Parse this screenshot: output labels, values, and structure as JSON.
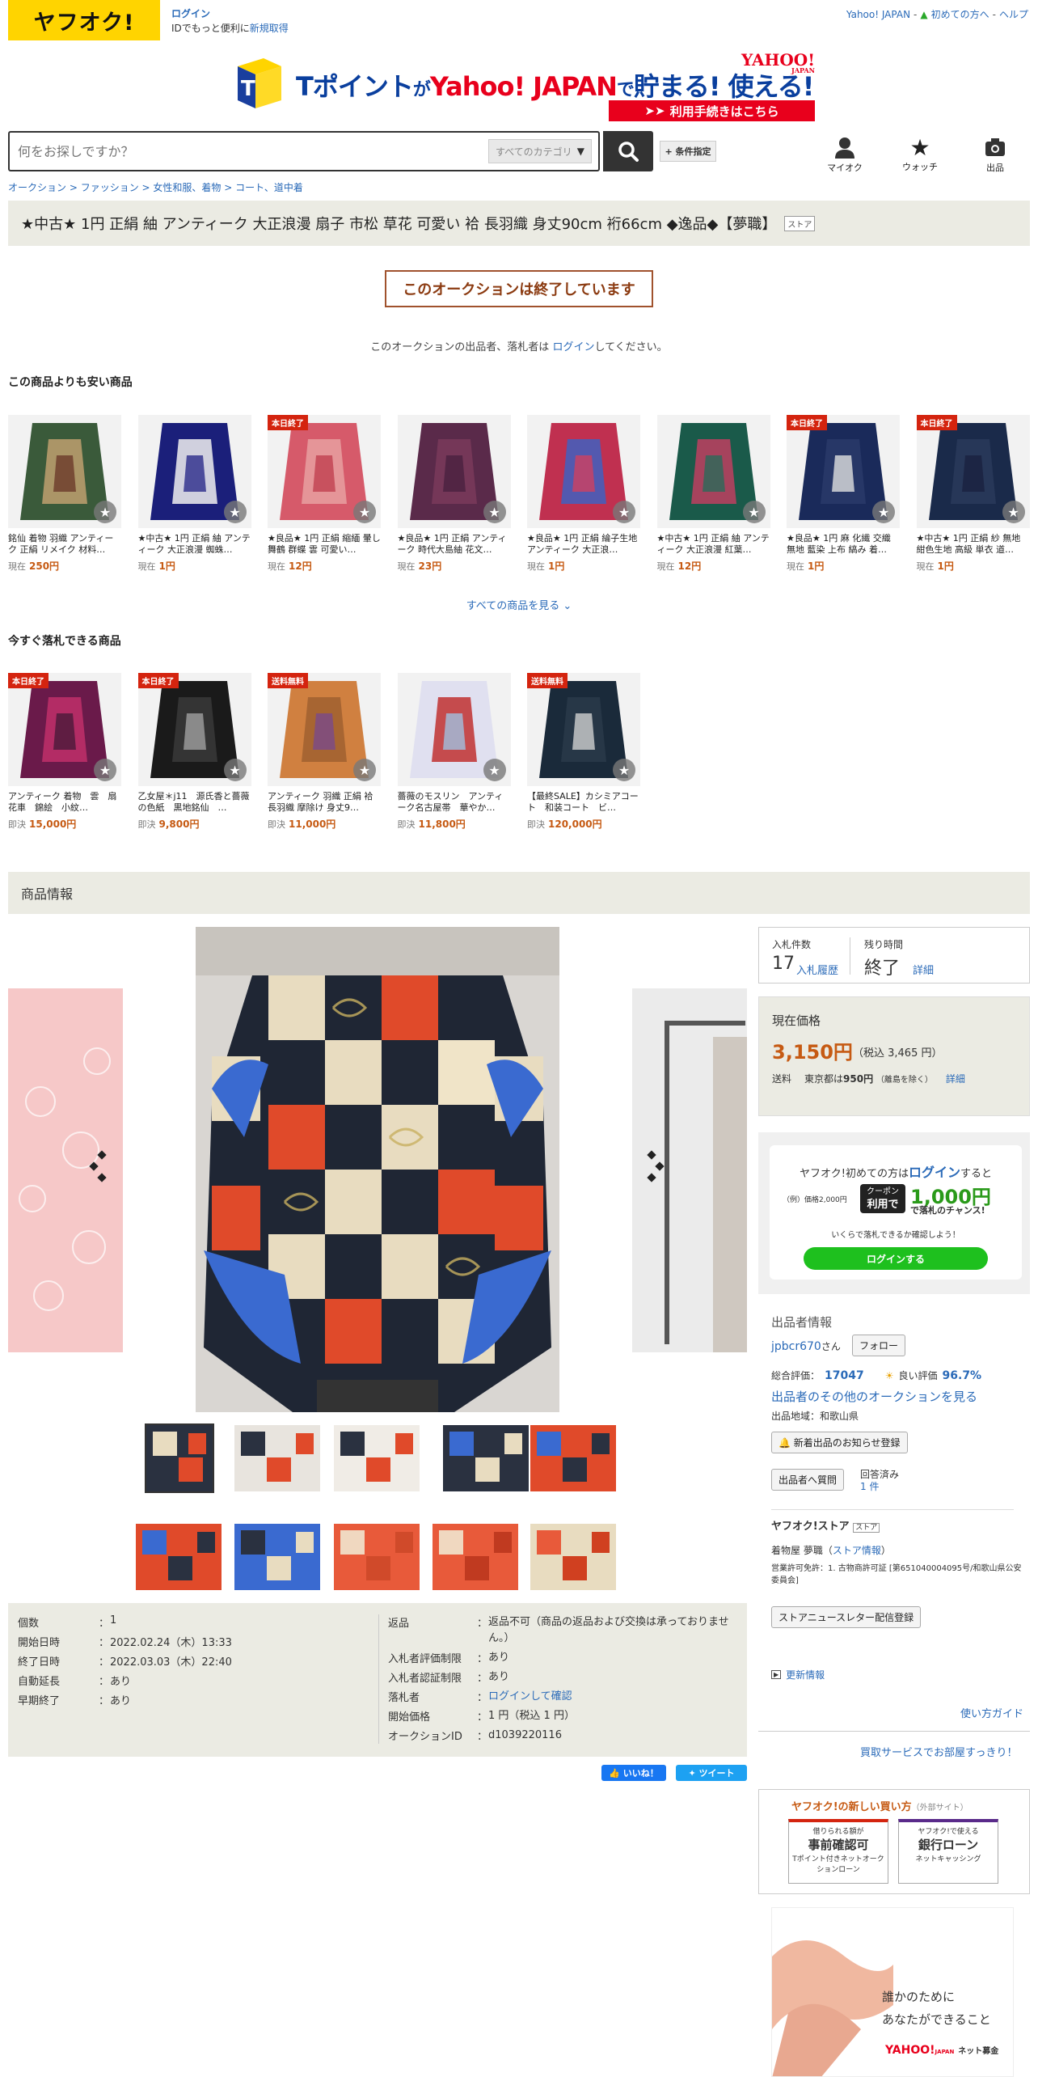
{
  "header": {
    "logo": "ヤフオク!",
    "login": "ログイン",
    "login_sub_prefix": "IDでもっと便利に",
    "register": "新規取得",
    "nav": [
      "Yahoo! JAPAN",
      "初めての方へ",
      "ヘルプ"
    ]
  },
  "banner": {
    "tpoint": "Tポイント",
    "ga": "が",
    "yahoo": "Yahoo! JAPAN",
    "de": "で",
    "tamaru": "貯まる!",
    "tsukaeru": "使える!",
    "yj_logo": "YAHOO!",
    "yj_sub": "JAPAN",
    "cta": "利用手続きはこちら"
  },
  "search": {
    "placeholder": "何をお探しですか？",
    "category": "すべてのカテゴリ",
    "condition": "+ 条件指定"
  },
  "header_icons": [
    {
      "label": "マイオク",
      "icon": "person-icon"
    },
    {
      "label": "ウォッチ",
      "icon": "star-icon"
    },
    {
      "label": "出品",
      "icon": "camera-icon"
    }
  ],
  "breadcrumb": [
    "オークション",
    "ファッション",
    "女性和服、着物",
    "コート、道中着"
  ],
  "item_title": "★中古★ 1円 正絹 紬 アンティーク 大正浪漫 扇子 市松 草花 可愛い 袷 長羽織 身丈90cm 裄66cm ◆逸品◆【夢職】",
  "store_badge": "ストア",
  "ended_message": "このオークションは終了しています",
  "ended_note": {
    "before": "このオークションの出品者、落札者は ",
    "link": "ログイン",
    "after": "してください。"
  },
  "cheaper": {
    "title": "この商品よりも安い商品",
    "items": [
      {
        "title": "銘仙 着物 羽織 アンティーク 正絹 リメイク 材料…",
        "label": "現在",
        "price": "250円",
        "badge": "",
        "colors": [
          "#3a5a3a",
          "#c0a070",
          "#6b3a2a"
        ]
      },
      {
        "title": "★中古★ 1円 正絹 紬 アンティーク 大正浪漫 蜘蛛…",
        "label": "現在",
        "price": "1円",
        "badge": "",
        "colors": [
          "#1b1f7a",
          "#f0f0f0",
          "#2a2a8a"
        ]
      },
      {
        "title": "★良品★ 1円 正絹 縮緬 暈し 舞鶴 群蝶 雲 可愛い…",
        "label": "現在",
        "price": "12円",
        "badge": "本日終了",
        "colors": [
          "#d65a6a",
          "#e8a0a0",
          "#c04050"
        ]
      },
      {
        "title": "★良品★ 1円 正絹 アンティーク 時代大島紬 花文…",
        "label": "現在",
        "price": "23円",
        "badge": "",
        "colors": [
          "#5a2a4a",
          "#7a3a5a",
          "#4a2040"
        ]
      },
      {
        "title": "★良品★ 1円 正絹 綸子生地 アンティーク 大正浪…",
        "label": "現在",
        "price": "1円",
        "badge": "",
        "colors": [
          "#c03050",
          "#4060c0",
          "#d04060"
        ]
      },
      {
        "title": "★中古★ 1円 正絹 紬 アンティーク 大正浪漫 紅葉…",
        "label": "現在",
        "price": "12円",
        "badge": "",
        "colors": [
          "#1a5a4a",
          "#c04060",
          "#2a6a5a"
        ]
      },
      {
        "title": "★良品★ 1円 麻 化繊 交織 無地 藍染 上布 縞み 着…",
        "label": "現在",
        "price": "1円",
        "badge": "本日終了",
        "colors": [
          "#1a2a5a",
          "#2a3a6a",
          "#e0e0e0"
        ]
      },
      {
        "title": "★中古★ 1円 正絹 紗 無地 紺色生地 高級 単衣 道…",
        "label": "現在",
        "price": "1円",
        "badge": "本日終了",
        "colors": [
          "#1a2a4a",
          "#2a3a5a",
          "#1a2040"
        ]
      }
    ],
    "see_all": "すべての商品を見る"
  },
  "instant": {
    "title": "今すぐ落札できる商品",
    "items": [
      {
        "title": "アンティーク 着物　雲　扇　花車　錦絵　小紋…",
        "label": "即決",
        "price": "15,000円",
        "badge": "本日終了",
        "colors": [
          "#6a1a4a",
          "#c0306a",
          "#4a1a3a"
        ]
      },
      {
        "title": "乙女屋＊j11　源氏香と薔薇の色紙　黒地銘仙　…",
        "label": "即決",
        "price": "9,800円",
        "badge": "本日終了",
        "colors": [
          "#1a1a1a",
          "#3a3a3a",
          "#a0a0a0"
        ]
      },
      {
        "title": "アンティーク 羽織 正絹 袷 長羽織 摩除け 身丈9…",
        "label": "即決",
        "price": "11,000円",
        "badge": "送料無料",
        "colors": [
          "#d08040",
          "#a06030",
          "#7a4a8a"
        ]
      },
      {
        "title": "薔薇のモスリン　アンティーク名古屋帯　華やか…",
        "label": "即決",
        "price": "11,800円",
        "badge": "",
        "colors": [
          "#e0e0f0",
          "#c03030",
          "#a0c0e0"
        ]
      },
      {
        "title": "【最終SALE】カシミアコート　和装コート　ビ…",
        "label": "即決",
        "price": "120,000円",
        "badge": "送料無料",
        "colors": [
          "#1a2a3a",
          "#2a3a4a",
          "#d0d0d0"
        ]
      }
    ]
  },
  "info_title": "商品情報",
  "details_left": [
    {
      "k": "個数",
      "v": "1",
      "link": false
    },
    {
      "k": "開始日時",
      "v": "2022.02.24（木）13:33",
      "link": false
    },
    {
      "k": "終了日時",
      "v": "2022.03.03（木）22:40",
      "link": false
    },
    {
      "k": "自動延長",
      "v": "あり",
      "link": true
    },
    {
      "k": "早期終了",
      "v": "あり",
      "link": true
    }
  ],
  "details_right": [
    {
      "k": "返品",
      "v": "返品不可（商品の返品および交換は承っておりません。）",
      "link": false,
      "vlink": false
    },
    {
      "k": "入札者評価制限",
      "v": "あり",
      "link": true,
      "vlink": false
    },
    {
      "k": "入札者認証制限",
      "v": "あり",
      "link": true,
      "vlink": false
    },
    {
      "k": "落札者",
      "v": "ログインして確認",
      "link": false,
      "vlink": true
    },
    {
      "k": "開始価格",
      "v": "1 円（税込 1 円）",
      "link": false,
      "vlink": false
    },
    {
      "k": "オークションID",
      "v": "d1039220116",
      "link": false,
      "vlink": false
    }
  ],
  "social": {
    "like": "いいね！",
    "tweet": "ツイート"
  },
  "bid": {
    "count_label": "入札件数",
    "count": "17",
    "history": "入札履歴",
    "time_label": "残り時間",
    "time": "終了",
    "detail": "詳細"
  },
  "price": {
    "label": "現在価格",
    "value": "3,150円",
    "tax": "（税込 3,465 円）",
    "ship_label": "送料",
    "ship_area": "東京都は",
    "ship_price": "950円",
    "ship_note": "（離島を除く）",
    "ship_detail": "詳細"
  },
  "coupon": {
    "line_a": "ヤフオク!初めての方は",
    "line_login": "ログイン",
    "line_b": "すると",
    "example": "（例）価格2,000円",
    "coupon_top": "クーポン",
    "coupon_bottom": "利用で",
    "amount": "1,000円",
    "chance": "で落札のチャンス!",
    "check": "いくらで落札できるか確認しよう！",
    "button": "ログインする"
  },
  "seller": {
    "title": "出品者情報",
    "name": "jpbcr670",
    "san": "さん",
    "follow": "フォロー",
    "rating_label": "総合評価：",
    "rating": "17047",
    "good_label": "良い評価",
    "good_pct": "96.7%",
    "other": "出品者のその他のオークションを見る",
    "region": "出品地域：和歌山県",
    "notify": "新着出品のお知らせ登録",
    "question": "出品者へ質問",
    "answered": "回答済み",
    "answered_count": "1 件",
    "store_title": "ヤフオク!ストア",
    "store_badge": "ストア",
    "store_name": "着物屋 夢職",
    "store_info": "ストア情報",
    "license": "営業許可免許：1. 古物商許可証 [第651040004095号/和歌山県公安委員会]",
    "newsletter": "ストアニュースレター配信登録",
    "update": "更新情報",
    "guide": "使い方ガイド",
    "kaitori": "買取サービスでお部屋すっきり！",
    "newway": "ヤフオク!の新しい買い方",
    "external": "（外部サイト）",
    "loan1_top": "借りられる額が",
    "loan1_main": "事前確認可",
    "loan1_sub": "Tポイント付きネットオークションローン",
    "loan2_top": "ヤフオク!で使える",
    "loan2_main": "銀行ローン",
    "loan2_sub": "ネットキャッシング",
    "ad_text1": "誰かのために",
    "ad_text2": "あなたができること",
    "ad_brand": "YAHOO!",
    "ad_brand_sub": "JAPAN",
    "ad_kikin": "ネット募金"
  }
}
